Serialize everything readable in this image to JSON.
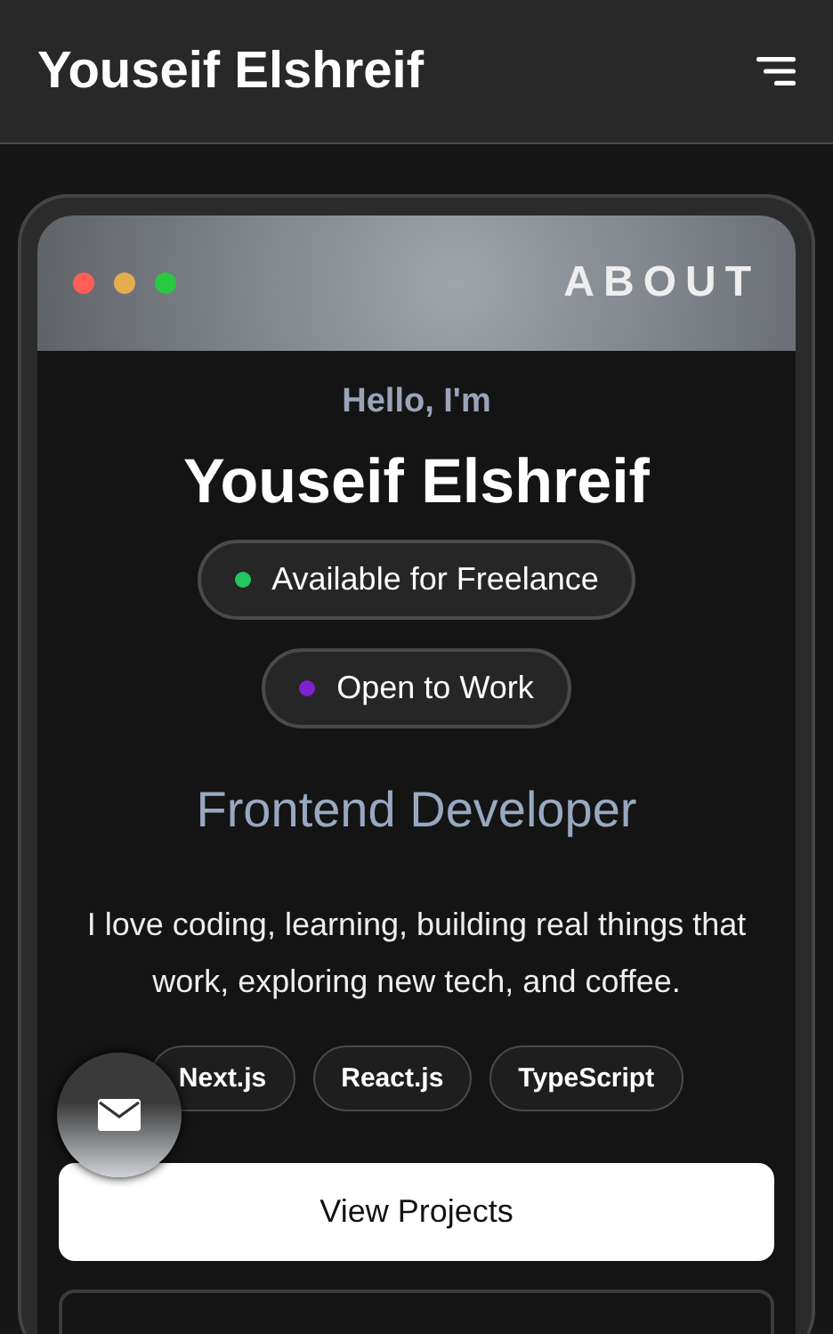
{
  "header": {
    "title": "Youseif Elshreif"
  },
  "window": {
    "title": "ABOUT"
  },
  "greeting": "Hello, I'm",
  "name": "Youseif Elshreif",
  "statuses": [
    {
      "label": "Available for Freelance",
      "color": "#22c55e"
    },
    {
      "label": "Open to Work",
      "color": "#7e22ce"
    }
  ],
  "role": "Frontend Developer",
  "bio": "I love coding, learning, building real things that work, exploring new tech, and coffee.",
  "tags": [
    "Next.js",
    "React.js",
    "TypeScript"
  ],
  "buttons": [
    {
      "label": "View Projects",
      "kind": "primary"
    },
    {
      "kind": "outline"
    }
  ]
}
